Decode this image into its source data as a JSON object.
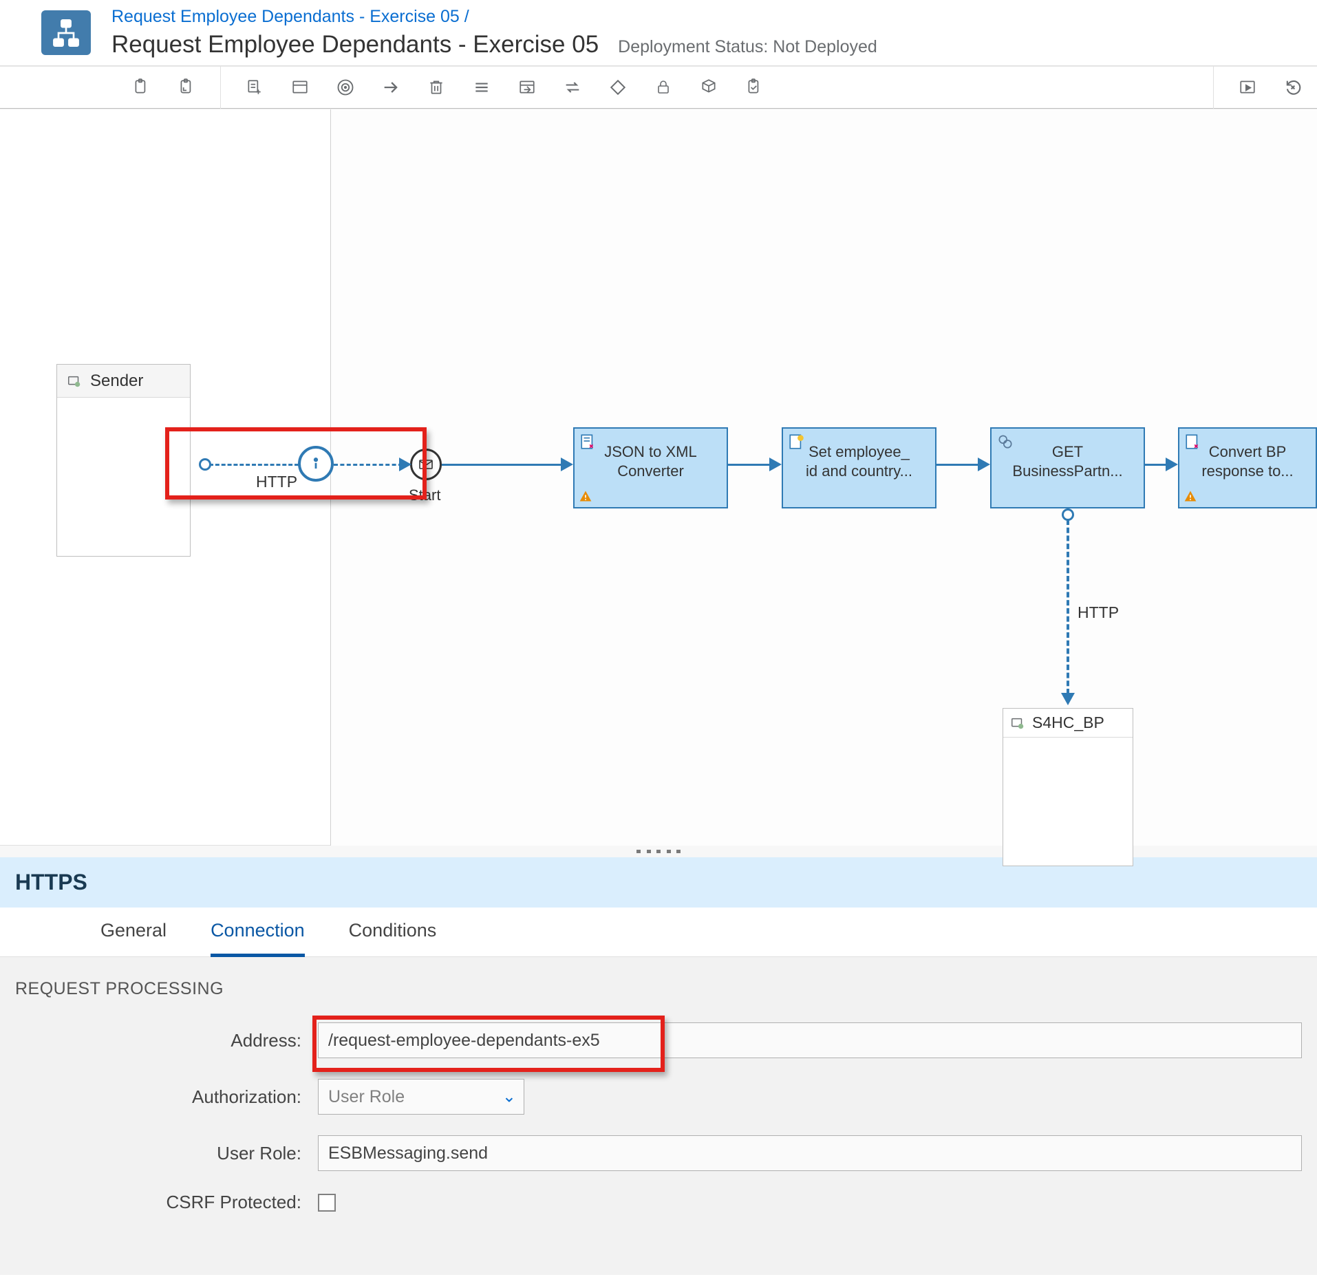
{
  "header": {
    "breadcrumb_text": "Request Employee Dependants - Exercise 05",
    "breadcrumb_sep": "/",
    "title": "Request Employee Dependants - Exercise 05",
    "status_label": "Deployment Status:",
    "status_value": "Not Deployed"
  },
  "toolbar": {
    "icons": [
      "copy-icon",
      "paste-icon",
      "sep",
      "add-iflow-icon",
      "window-icon",
      "target-icon",
      "arrow-icon",
      "trash-icon",
      "menu-lines-icon",
      "import-icon",
      "swap-icon",
      "diamond-icon",
      "lock-icon",
      "cube-icon",
      "check-doc-icon",
      "sep",
      "play-icon",
      "rewind-cancel-icon"
    ]
  },
  "canvas": {
    "sender_label": "Sender",
    "http_label": "HTTP",
    "start_label": "Start",
    "nodes": [
      {
        "id": "n1",
        "label1": "JSON to XML",
        "label2": "Converter",
        "warn": true
      },
      {
        "id": "n2",
        "label1": "Set employee_",
        "label2": "id and country...",
        "warn": false
      },
      {
        "id": "n3",
        "label1": "GET",
        "label2": "BusinessPartn...",
        "warn": false
      },
      {
        "id": "n4",
        "label1": "Convert BP",
        "label2": "response to...",
        "warn": true
      }
    ],
    "down_label": "HTTP",
    "receiver_label": "S4HC_BP"
  },
  "panel": {
    "title": "HTTPS",
    "tabs": [
      "General",
      "Connection",
      "Conditions"
    ],
    "active_tab_index": 1,
    "section": "REQUEST PROCESSING",
    "fields": {
      "address_label": "Address:",
      "address_value": "/request-employee-dependants-ex5",
      "auth_label": "Authorization:",
      "auth_value": "User Role",
      "role_label": "User Role:",
      "role_value": "ESBMessaging.send",
      "csrf_label": "CSRF Protected:"
    }
  }
}
